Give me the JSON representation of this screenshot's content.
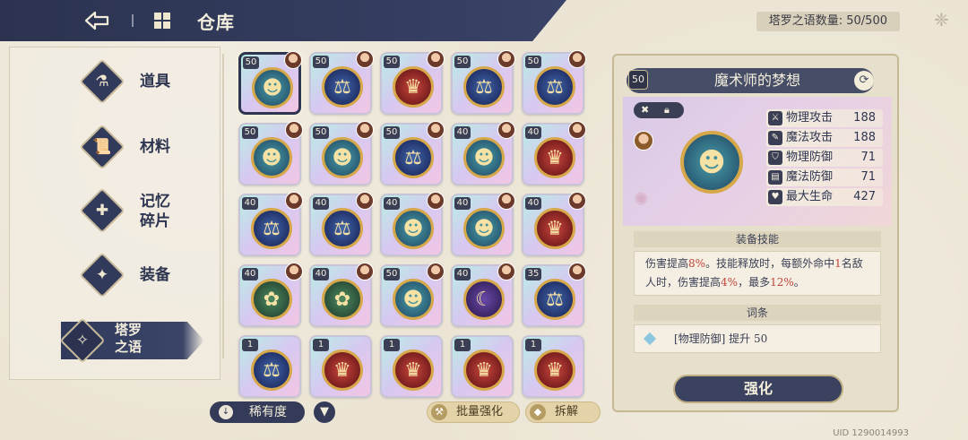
{
  "header": {
    "title": "仓库",
    "count_label": "塔罗之语数量: 50/500"
  },
  "categories": [
    {
      "label": "道具",
      "icon": "potion-icon"
    },
    {
      "label": "材料",
      "icon": "scroll-icon"
    },
    {
      "label": "记忆\n碎片",
      "icon": "puzzle-icon"
    },
    {
      "label": "装备",
      "icon": "armor-icon"
    },
    {
      "label": "塔罗\n之语",
      "icon": "tarot-icon",
      "active": true
    }
  ],
  "grid": {
    "items": [
      {
        "level": "50",
        "emblem": "teal"
      },
      {
        "level": "50",
        "emblem": "blue"
      },
      {
        "level": "50",
        "emblem": "red"
      },
      {
        "level": "50",
        "emblem": "blue"
      },
      {
        "level": "50",
        "emblem": "blue"
      },
      {
        "level": "50",
        "emblem": "teal"
      },
      {
        "level": "50",
        "emblem": "teal"
      },
      {
        "level": "50",
        "emblem": "blue"
      },
      {
        "level": "40",
        "emblem": "teal"
      },
      {
        "level": "40",
        "emblem": "red"
      },
      {
        "level": "40",
        "emblem": "blue"
      },
      {
        "level": "40",
        "emblem": "blue"
      },
      {
        "level": "40",
        "emblem": "teal"
      },
      {
        "level": "40",
        "emblem": "teal"
      },
      {
        "level": "40",
        "emblem": "red"
      },
      {
        "level": "40",
        "emblem": "green"
      },
      {
        "level": "40",
        "emblem": "green"
      },
      {
        "level": "50",
        "emblem": "teal"
      },
      {
        "level": "40",
        "emblem": "purple"
      },
      {
        "level": "35",
        "emblem": "blue"
      },
      {
        "level": "1",
        "emblem": "blue"
      },
      {
        "level": "1",
        "emblem": "red"
      },
      {
        "level": "1",
        "emblem": "red"
      },
      {
        "level": "1",
        "emblem": "red"
      },
      {
        "level": "1",
        "emblem": "red"
      }
    ]
  },
  "bottom": {
    "rarity_label": "稀有度",
    "batch_label": "批量强化",
    "dismantle_label": "拆解"
  },
  "detail": {
    "level": "50",
    "name": "魔术师的梦想",
    "stats": [
      {
        "name": "物理攻击",
        "value": "188",
        "icon": "sword-icon"
      },
      {
        "name": "魔法攻击",
        "value": "188",
        "icon": "wand-icon"
      },
      {
        "name": "物理防御",
        "value": "71",
        "icon": "shield-icon"
      },
      {
        "name": "魔法防御",
        "value": "71",
        "icon": "book-icon"
      },
      {
        "name": "最大生命",
        "value": "427",
        "icon": "heart-icon"
      }
    ],
    "skill_title": "装备技能",
    "skill_text_parts": [
      "伤害提高",
      "8%",
      "。技能释放时，每额外命中",
      "1",
      "名敌人时，伤害提高",
      "4%",
      "，最多",
      "12%",
      "。"
    ],
    "affix_title": "词条",
    "affix_text": "[物理防御] 提升 50",
    "enhance_label": "强化"
  },
  "uid": "UID 1290014993",
  "colors": {
    "navy": "#2e3550",
    "cream": "#ece6d8",
    "highlight": "#c2443a",
    "gold": "#d6a84a"
  }
}
